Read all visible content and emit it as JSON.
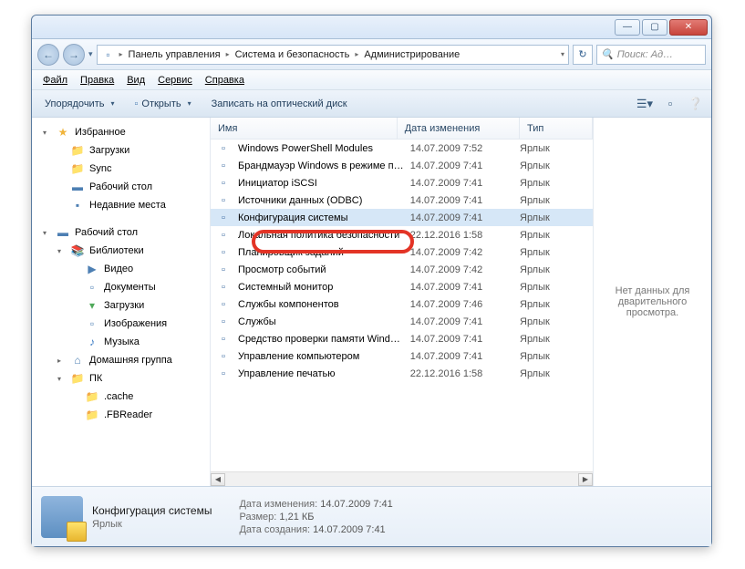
{
  "titlebar": {
    "min": "—",
    "max": "▢",
    "close": "✕"
  },
  "nav": {
    "back": "←",
    "fwd": "→",
    "dropdown": "▾",
    "refresh": "↻"
  },
  "breadcrumb": [
    "Панель управления",
    "Система и безопасность",
    "Администрирование"
  ],
  "search": {
    "placeholder": "Поиск: Ад…"
  },
  "menu": {
    "file": "Файл",
    "edit": "Правка",
    "view": "Вид",
    "tools": "Сервис",
    "help": "Справка"
  },
  "toolbar": {
    "organize": "Упорядочить",
    "open": "Открыть",
    "burn": "Записать на оптический диск"
  },
  "columns": {
    "name": "Имя",
    "date": "Дата изменения",
    "type": "Тип"
  },
  "tree": [
    {
      "label": "Избранное",
      "icon": "★",
      "cls": "star",
      "lvl": 0,
      "exp": "▾"
    },
    {
      "label": "Загрузки",
      "icon": "📁",
      "cls": "fld",
      "lvl": 1
    },
    {
      "label": "Sync",
      "icon": "📁",
      "cls": "fld",
      "lvl": 1
    },
    {
      "label": "Рабочий стол",
      "icon": "▬",
      "cls": "desk",
      "lvl": 1
    },
    {
      "label": "Недавние места",
      "icon": "▪",
      "cls": "blue",
      "lvl": 1
    },
    {
      "spacer": true
    },
    {
      "label": "Рабочий стол",
      "icon": "▬",
      "cls": "desk",
      "lvl": 0,
      "exp": "▾"
    },
    {
      "label": "Библиотеки",
      "icon": "📚",
      "cls": "lib",
      "lvl": 1,
      "exp": "▾"
    },
    {
      "label": "Видео",
      "icon": "▶",
      "cls": "blue",
      "lvl": 2
    },
    {
      "label": "Документы",
      "icon": "▫",
      "cls": "blue",
      "lvl": 2
    },
    {
      "label": "Загрузки",
      "icon": "▾",
      "cls": "green",
      "lvl": 2
    },
    {
      "label": "Изображения",
      "icon": "▫",
      "cls": "blue",
      "lvl": 2
    },
    {
      "label": "Музыка",
      "icon": "♪",
      "cls": "music",
      "lvl": 2
    },
    {
      "label": "Домашняя группа",
      "icon": "⌂",
      "cls": "blue",
      "lvl": 1,
      "exp": "▸"
    },
    {
      "label": "ПК",
      "icon": "📁",
      "cls": "fld",
      "lvl": 1,
      "exp": "▾"
    },
    {
      "label": ".cache",
      "icon": "📁",
      "cls": "fld",
      "lvl": 2
    },
    {
      "label": ".FBReader",
      "icon": "📁",
      "cls": "fld",
      "lvl": 2
    }
  ],
  "files": [
    {
      "name": "Windows PowerShell Modules",
      "date": "14.07.2009 7:52",
      "type": "Ярлык"
    },
    {
      "name": "Брандмауэр Windows в режиме повы…",
      "date": "14.07.2009 7:41",
      "type": "Ярлык"
    },
    {
      "name": "Инициатор iSCSI",
      "date": "14.07.2009 7:41",
      "type": "Ярлык"
    },
    {
      "name": "Источники данных (ODBC)",
      "date": "14.07.2009 7:41",
      "type": "Ярлык"
    },
    {
      "name": "Конфигурация системы",
      "date": "14.07.2009 7:41",
      "type": "Ярлык",
      "sel": true
    },
    {
      "name": "Локальная политика безопасности",
      "date": "22.12.2016 1:58",
      "type": "Ярлык"
    },
    {
      "name": "Планировщик заданий",
      "date": "14.07.2009 7:42",
      "type": "Ярлык"
    },
    {
      "name": "Просмотр событий",
      "date": "14.07.2009 7:42",
      "type": "Ярлык"
    },
    {
      "name": "Системный монитор",
      "date": "14.07.2009 7:41",
      "type": "Ярлык"
    },
    {
      "name": "Службы компонентов",
      "date": "14.07.2009 7:46",
      "type": "Ярлык"
    },
    {
      "name": "Службы",
      "date": "14.07.2009 7:41",
      "type": "Ярлык"
    },
    {
      "name": "Средство проверки памяти Windows",
      "date": "14.07.2009 7:41",
      "type": "Ярлык"
    },
    {
      "name": "Управление компьютером",
      "date": "14.07.2009 7:41",
      "type": "Ярлык"
    },
    {
      "name": "Управление печатью",
      "date": "22.12.2016 1:58",
      "type": "Ярлык"
    }
  ],
  "preview": {
    "text": "Нет данных для дварительного просмотра."
  },
  "details": {
    "name": "Конфигурация системы",
    "type": "Ярлык",
    "props": [
      {
        "label": "Дата изменения:",
        "value": "14.07.2009 7:41"
      },
      {
        "label": "Размер:",
        "value": "1,21 КБ"
      },
      {
        "label": "Дата создания:",
        "value": "14.07.2009 7:41"
      }
    ]
  }
}
